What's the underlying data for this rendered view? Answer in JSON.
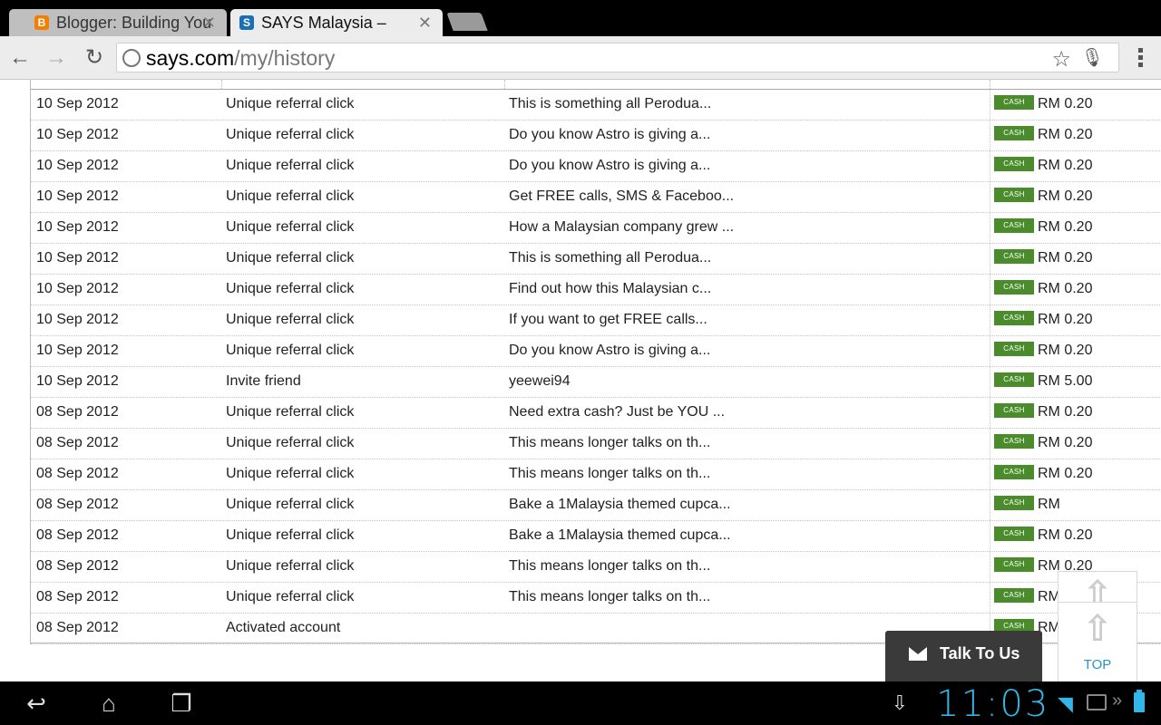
{
  "browser": {
    "tabs": [
      {
        "title": "Blogger: Building You",
        "favicon": "blogger-icon",
        "favicon_color": "#f57d00",
        "favicon_glyph": "B"
      },
      {
        "title": "SAYS Malaysia –",
        "favicon": "says-icon",
        "favicon_color": "#1a6fb5",
        "favicon_glyph": "S"
      }
    ],
    "address": {
      "host": "says.com",
      "path": "/my/history"
    }
  },
  "history": {
    "rows": [
      {
        "date": "10 Sep 2012",
        "type": "Unique referral click",
        "desc": "This is something all Perodua...",
        "badge": "CASH",
        "amount": "RM 0.20"
      },
      {
        "date": "10 Sep 2012",
        "type": "Unique referral click",
        "desc": "Do you know Astro is giving a...",
        "badge": "CASH",
        "amount": "RM 0.20"
      },
      {
        "date": "10 Sep 2012",
        "type": "Unique referral click",
        "desc": "Do you know Astro is giving a...",
        "badge": "CASH",
        "amount": "RM 0.20"
      },
      {
        "date": "10 Sep 2012",
        "type": "Unique referral click",
        "desc": "Get FREE calls, SMS & Faceboo...",
        "badge": "CASH",
        "amount": "RM 0.20"
      },
      {
        "date": "10 Sep 2012",
        "type": "Unique referral click",
        "desc": "How a Malaysian company grew ...",
        "badge": "CASH",
        "amount": "RM 0.20"
      },
      {
        "date": "10 Sep 2012",
        "type": "Unique referral click",
        "desc": "This is something all Perodua...",
        "badge": "CASH",
        "amount": "RM 0.20"
      },
      {
        "date": "10 Sep 2012",
        "type": "Unique referral click",
        "desc": "Find out how this Malaysian c...",
        "badge": "CASH",
        "amount": "RM 0.20"
      },
      {
        "date": "10 Sep 2012",
        "type": "Unique referral click",
        "desc": "If you want to get FREE calls...",
        "badge": "CASH",
        "amount": "RM 0.20"
      },
      {
        "date": "10 Sep 2012",
        "type": "Unique referral click",
        "desc": "Do you know Astro is giving a...",
        "badge": "CASH",
        "amount": "RM 0.20"
      },
      {
        "date": "10 Sep 2012",
        "type": "Invite friend",
        "desc": "yeewei94",
        "badge": "CASH",
        "amount": "RM 5.00"
      },
      {
        "date": "08 Sep 2012",
        "type": "Unique referral click",
        "desc": "Need extra cash? Just be YOU ...",
        "badge": "CASH",
        "amount": "RM 0.20"
      },
      {
        "date": "08 Sep 2012",
        "type": "Unique referral click",
        "desc": "This means longer talks on th...",
        "badge": "CASH",
        "amount": "RM 0.20"
      },
      {
        "date": "08 Sep 2012",
        "type": "Unique referral click",
        "desc": "This means longer talks on th...",
        "badge": "CASH",
        "amount": "RM 0.20"
      },
      {
        "date": "08 Sep 2012",
        "type": "Unique referral click",
        "desc": "Bake a 1Malaysia themed cupca...",
        "badge": "CASH",
        "amount": "RM"
      },
      {
        "date": "08 Sep 2012",
        "type": "Unique referral click",
        "desc": "Bake a 1Malaysia themed cupca...",
        "badge": "CASH",
        "amount": "RM 0.20"
      },
      {
        "date": "08 Sep 2012",
        "type": "Unique referral click",
        "desc": "This means longer talks on th...",
        "badge": "CASH",
        "amount": "RM 0.20"
      },
      {
        "date": "08 Sep 2012",
        "type": "Unique referral click",
        "desc": "This means longer talks on th...",
        "badge": "CASH",
        "amount": "RM 0.20"
      },
      {
        "date": "08 Sep 2012",
        "type": "Activated account",
        "desc": "",
        "badge": "CASH",
        "amount": "RM"
      }
    ]
  },
  "widgets": {
    "talk_label": "Talk To Us",
    "top_label": "TOP"
  },
  "system": {
    "clock": "11:03"
  },
  "colors": {
    "cash_badge": "#4a8b2c",
    "accent": "#33b5e5",
    "top_link": "#2f8fc6"
  }
}
